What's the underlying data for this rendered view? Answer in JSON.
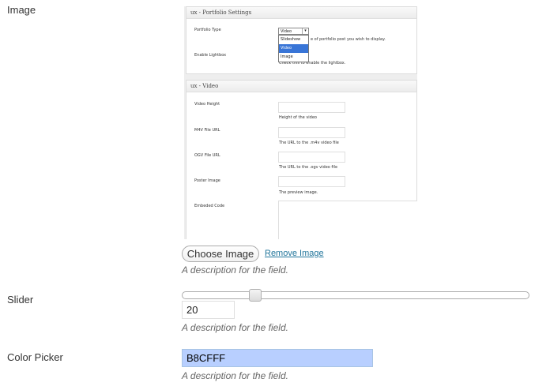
{
  "image_field": {
    "label": "Image",
    "choose_button": "Choose Image",
    "remove_link": "Remove Image",
    "description": "A description for the field.",
    "preview": {
      "portfolio_box": {
        "title": "ux - Portfolio Settings",
        "portfolio_type_label": "Portfolio Type",
        "portfolio_type_value": "Video",
        "portfolio_type_options": [
          "Slideshow",
          "Video",
          "Image"
        ],
        "portfolio_type_help": "e of portfolio post you wish to display.",
        "lightbox_label": "Enable Lightbox",
        "lightbox_help": "Check this to enable the lightbox."
      },
      "video_box": {
        "title": "ux - Video",
        "fields": [
          {
            "label": "Video Height",
            "help": "Height of the video"
          },
          {
            "label": "M4V File URL",
            "help": "The URL to the .m4v video file"
          },
          {
            "label": "OGV File URL",
            "help": "The URL to the .ogv video file"
          },
          {
            "label": "Poster Image",
            "help": "The preview image."
          }
        ],
        "embed_label": "Embeded Code"
      }
    }
  },
  "slider_field": {
    "label": "Slider",
    "value": "20",
    "position_fraction": 0.2,
    "description": "A description for the field."
  },
  "color_field": {
    "label": "Color Picker",
    "value": "B8CFFF",
    "swatch_color": "#B8CFFF",
    "description": "A description for the field."
  },
  "colors": {
    "link": "#21759b",
    "dropdown_selected": "#3875d7"
  }
}
